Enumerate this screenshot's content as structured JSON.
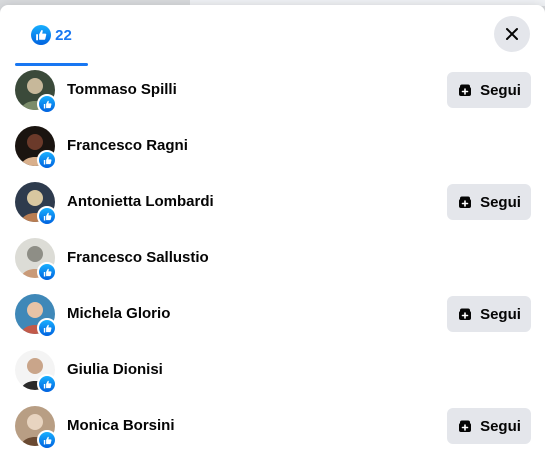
{
  "tabs": [
    {
      "reaction": "like-icon",
      "count": "22",
      "selected": true
    }
  ],
  "colors": {
    "accent": "#1877f2",
    "button_bg": "#e4e6eb",
    "text": "#050505"
  },
  "people": [
    {
      "name": "Tommaso Spilli",
      "follow_label": "Segui",
      "show_follow": true,
      "avatar_tones": [
        "#3b4a3a",
        "#7b8c6a",
        "#c7b89a"
      ]
    },
    {
      "name": "Francesco Ragni",
      "follow_label": "",
      "show_follow": false,
      "avatar_tones": [
        "#1a1410",
        "#d9b08c",
        "#6b3a2a"
      ]
    },
    {
      "name": "Antonietta Lombardi",
      "follow_label": "Segui",
      "show_follow": true,
      "avatar_tones": [
        "#2e3b4d",
        "#b97d52",
        "#d8c7a0"
      ]
    },
    {
      "name": "Francesco Sallustio",
      "follow_label": "",
      "show_follow": false,
      "avatar_tones": [
        "#dcdcd6",
        "#c99a78",
        "#8e8e86"
      ]
    },
    {
      "name": "Michela Glorio",
      "follow_label": "Segui",
      "show_follow": true,
      "avatar_tones": [
        "#3f88b8",
        "#c25a4a",
        "#e8c3a6"
      ]
    },
    {
      "name": "Giulia Dionisi",
      "follow_label": "",
      "show_follow": false,
      "avatar_tones": [
        "#f4f4f4",
        "#2a2a2a",
        "#c9a58a"
      ]
    },
    {
      "name": "Monica Borsini",
      "follow_label": "Segui",
      "show_follow": true,
      "avatar_tones": [
        "#b89e84",
        "#6a4a32",
        "#e8d4c0"
      ]
    }
  ]
}
